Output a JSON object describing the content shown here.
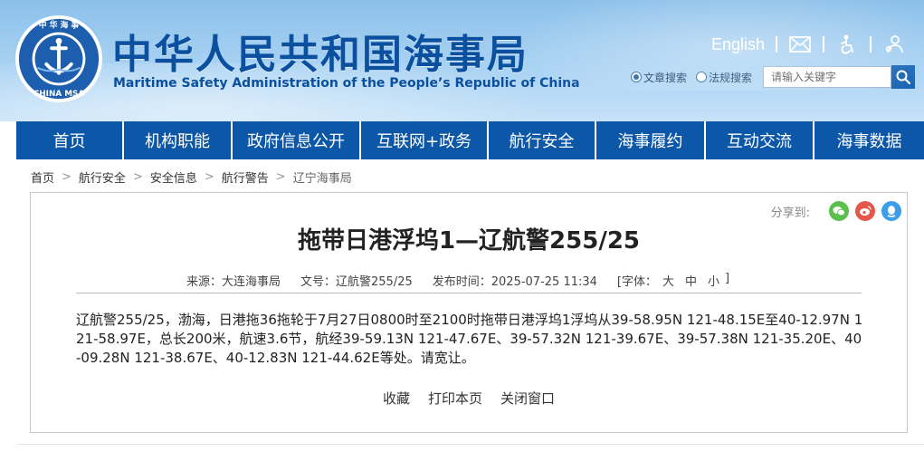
{
  "header": {
    "logo_top_text": "中 华 海 事",
    "logo_bottom_text": "CHINA MSA",
    "title_cn": "中华人民共和国海事局",
    "title_en": "Maritime Safety Administration of the People’s Republic of China",
    "english_link": "English",
    "icons": [
      "mail-icon",
      "accessibility-icon",
      "user-care-icon"
    ],
    "search": {
      "options": [
        {
          "label": "文章搜索",
          "selected": true
        },
        {
          "label": "法规搜索",
          "selected": false
        }
      ],
      "placeholder": "请输入关键字"
    }
  },
  "nav": [
    "首页",
    "机构职能",
    "政府信息公开",
    "互联网+政务",
    "航行安全",
    "海事履约",
    "互动交流",
    "海事数据"
  ],
  "breadcrumb": [
    "首页",
    "航行安全",
    "安全信息",
    "航行警告",
    "辽宁海事局"
  ],
  "article": {
    "share_label": "分享到:",
    "share_icons": [
      "wechat-icon",
      "weibo-icon",
      "qq-icon"
    ],
    "title": "拖带日港浮坞1—辽航警255/25",
    "meta": {
      "source": "来源：大连海事局",
      "doc_no": "文号：辽航警255/25",
      "publish": "发布时间：2025-07-25 11:34",
      "font_label": "[字体：",
      "font_sizes": [
        "大",
        "中",
        "小"
      ],
      "font_close": "]"
    },
    "body": "辽航警255/25，渤海，日港拖36拖轮于7月27日0800时至2100时拖带日港浮坞1浮坞从39-58.95N 121-48.15E至40-12.97N 121-58.97E，总长200米，航速3.6节，航经39-59.13N 121-47.67E、39-57.32N 121-39.67E、39-57.38N 121-35.20E、40-09.28N 121-38.67E、40-12.83N 121-44.62E等处。请宽让。",
    "actions": [
      "收藏",
      "打印本页",
      "关闭窗口"
    ]
  },
  "colors": {
    "brand_blue": "#0c57a8",
    "title_blue": "#0b4f9f",
    "wechat": "#5bbf4e",
    "weibo": "#e4574b",
    "qq": "#3a9ee8"
  }
}
